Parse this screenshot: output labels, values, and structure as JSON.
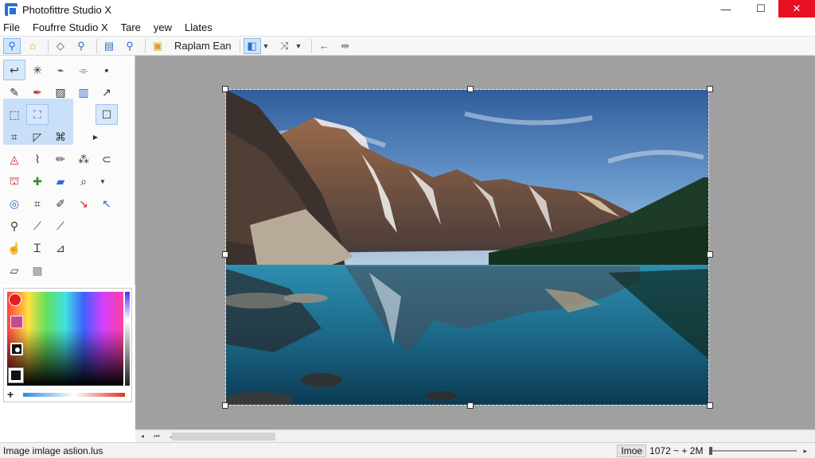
{
  "window": {
    "title": "Photofittre Studio X",
    "minimize": "—",
    "maximize": "☐",
    "close": "✕"
  },
  "menu": [
    "File",
    "Foufrre Studio X",
    "Tare",
    "yew",
    "Llates"
  ],
  "toolbar": {
    "label": "Raplam  Ean"
  },
  "statusbar": {
    "left": "Image imlage aslion.lus",
    "box": "Imoe",
    "value": "1072 ~ + 2M",
    "arrow": "▸",
    "zoom_fraction": 0.0
  },
  "colors": {
    "accent": "#2b6cd0",
    "close": "#e81123",
    "workspace": "#a0a0a0",
    "selection": "#c9def7"
  },
  "tools": [
    [
      "lasso-icon",
      "wand-icon",
      "brush-icon",
      "eyedropper-icon",
      "pin-icon"
    ],
    [
      "pencil-icon",
      "pen-icon",
      "stamp-icon",
      "gradient-icon",
      "move-icon"
    ],
    [
      "marquee-icon",
      "select-icon",
      "",
      "",
      "rect-icon"
    ],
    [
      "crop-icon",
      "pointer-icon",
      "frame-icon",
      "",
      "more-icon"
    ]
  ]
}
